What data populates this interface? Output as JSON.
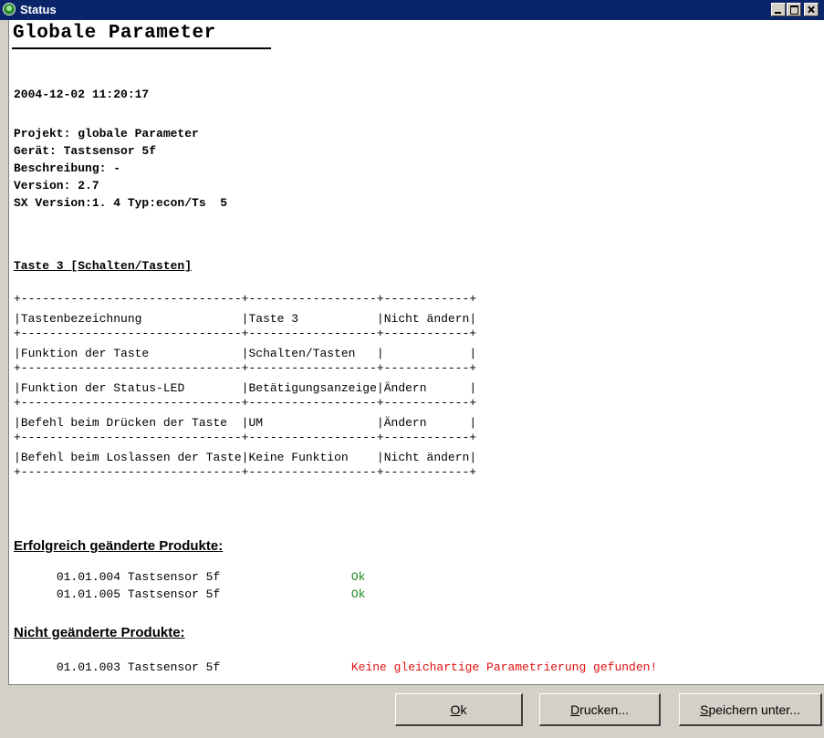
{
  "window": {
    "title": "Status",
    "icon": "status-app-icon"
  },
  "report": {
    "title": "Globale Parameter",
    "timestamp": "2004-12-02 11:20:17",
    "info": [
      "Projekt: globale Parameter",
      "Gerät: Tastsensor 5f",
      "Beschreibung: -",
      "Version: 2.7",
      "SX Version:1. 4 Typ:econ/Ts  5"
    ],
    "section_title": "Taste 3 [Schalten/Tasten]",
    "table": {
      "border": "+-------------------------------+------------------+------------+",
      "rows": [
        [
          "Tastenbezeichnung",
          "Taste 3",
          "Nicht ändern"
        ],
        [
          "Funktion der Taste",
          "Schalten/Tasten",
          ""
        ],
        [
          "Funktion der Status-LED",
          "Betätigungsanzeige",
          "Ändern"
        ],
        [
          "Befehl beim Drücken der Taste",
          "UM",
          "Ändern"
        ],
        [
          "Befehl beim Loslassen der Taste",
          "Keine Funktion",
          "Nicht ändern"
        ]
      ]
    },
    "changed": {
      "heading": "Erfolgreich geänderte Produkte:",
      "items": [
        {
          "name": "01.01.004 Tastsensor 5f",
          "status": "Ok"
        },
        {
          "name": "01.01.005 Tastsensor 5f",
          "status": "Ok"
        }
      ]
    },
    "unchanged": {
      "heading": "Nicht geänderte Produkte:",
      "items": [
        {
          "name": "01.01.003 Tastsensor 5f",
          "status": "Keine gleichartige Parametrierung gefunden!"
        }
      ]
    }
  },
  "buttons": {
    "ok": {
      "mnemonic": "O",
      "rest": "k"
    },
    "print": {
      "mnemonic": "D",
      "rest": "rucken..."
    },
    "save": {
      "mnemonic": "S",
      "rest": "peichern unter..."
    }
  },
  "colors": {
    "titlebar": "#0a246a",
    "ok_status": "#1a8a1a",
    "error_status": "#e01010"
  }
}
